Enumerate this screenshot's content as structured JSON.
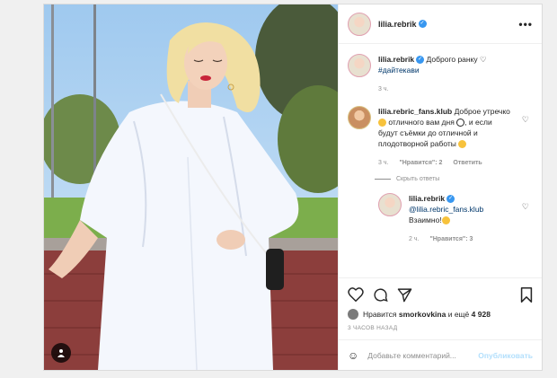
{
  "post": {
    "username": "lilia.rebrik",
    "more_label": "•••",
    "caption": {
      "username": "lilia.rebrik",
      "text": "Доброго ранку ♡",
      "hashtag": "#дайтекави",
      "time": "3 ч."
    },
    "comment": {
      "username": "lilia.rebric_fans.klub",
      "text_1": "Доброе утречко",
      "text_2": "отличного вам дня",
      "text_3": ", и если будут съёмки до отличной и плодотворной работы",
      "time": "3 ч.",
      "likes": "\"Нравится\": 2",
      "reply_label": "Ответить",
      "hide_replies": "Скрыть ответы"
    },
    "reply": {
      "username": "lilia.rebrik",
      "mention": "@lilia.rebric_fans.klub",
      "text": "Взаимно!",
      "time": "2 ч.",
      "likes": "\"Нравится\": 3"
    },
    "likes_line": {
      "prefix": "Нравится",
      "user": "smorkovkina",
      "middle": "и ещё",
      "count": "4 928"
    },
    "posted_time": "3 ЧАСОВ НАЗАД",
    "add_comment": {
      "placeholder": "Добавьте комментарий...",
      "publish": "Опубликовать"
    }
  },
  "icons": [
    "heart-icon",
    "comment-icon",
    "share-icon",
    "save-icon",
    "smile-icon",
    "user-tag-icon",
    "verified-icon"
  ],
  "colors": {
    "verified": "#3897f0",
    "publish_disabled": "#b2dffc",
    "muted": "#8e8e8e"
  }
}
